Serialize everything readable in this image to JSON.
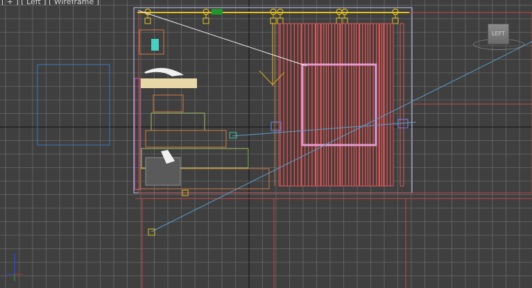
{
  "viewport": {
    "label_parts": [
      "[ + ]",
      "[ Left ]",
      "[ Wireframe ]"
    ]
  },
  "viewcube": {
    "face_label": "LEFT"
  },
  "colors": {
    "background": "#3f3f3f",
    "grid": "#6e6e6e",
    "axis": "#000000",
    "wall_outline": "#c24a4a",
    "curtain_fill": "#e05a5a",
    "selected_frame": "#e89ad0",
    "light_blue": "#5aa0d0",
    "yellow_helper": "#e0c020",
    "wood_tan": "#e8d8a8",
    "orange_box": "#d07a40",
    "green_box": "#a0c060"
  },
  "icons": {
    "world_axis": "axis-tripod-icon",
    "camera": "camera-icon",
    "light": "light-icon"
  }
}
